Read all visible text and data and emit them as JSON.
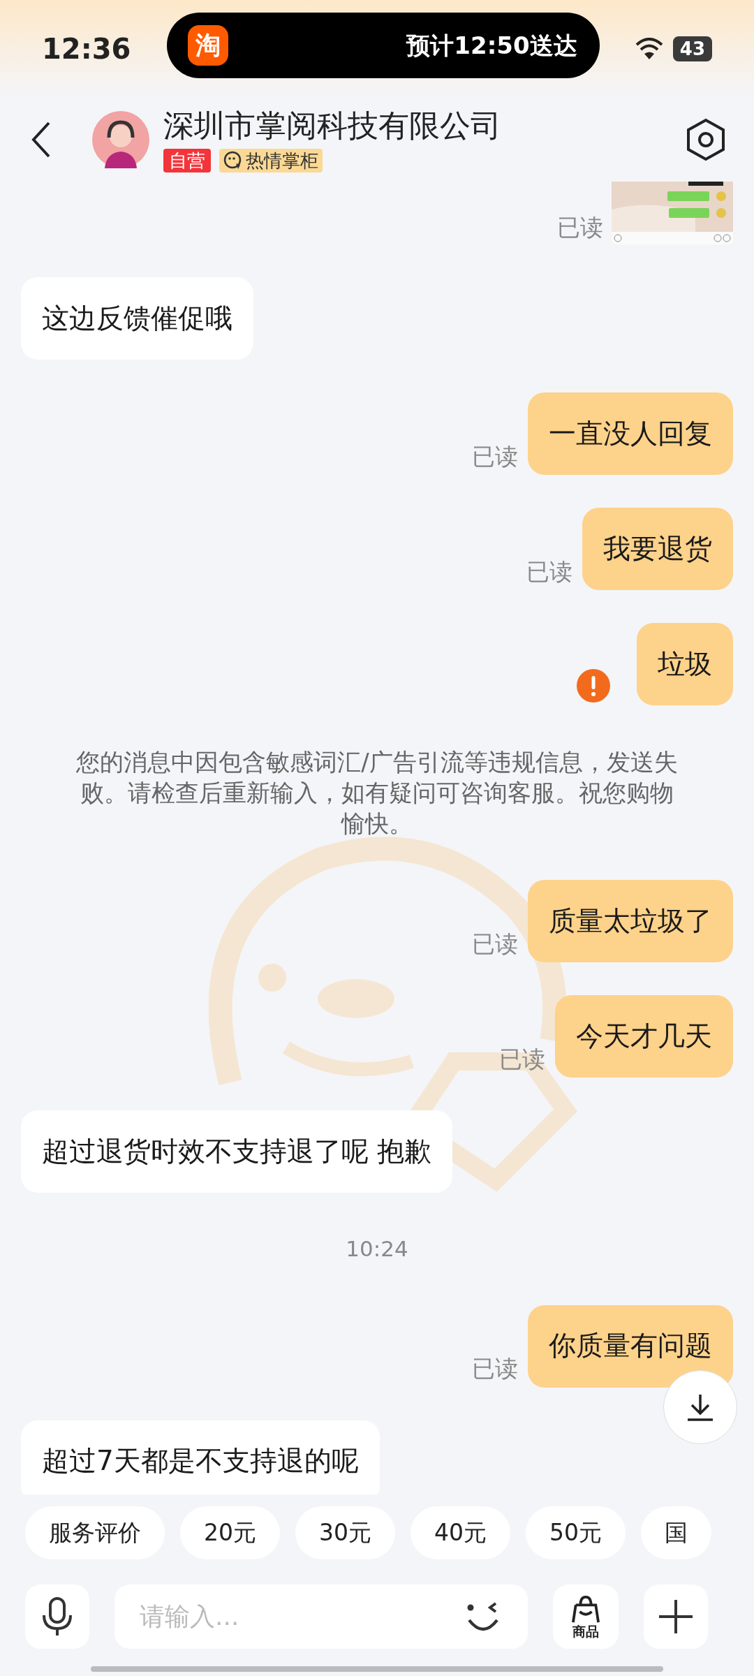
{
  "status_bar": {
    "time": "12:36",
    "island": {
      "app_glyph": "淘",
      "text": "预计12:50送达"
    },
    "battery": "43"
  },
  "header": {
    "title": "深圳市掌阅科技有限公司",
    "badges": [
      {
        "kind": "official",
        "label": "自营"
      },
      {
        "kind": "service",
        "label": "热情掌柜"
      }
    ]
  },
  "messages": [
    {
      "read_label": "已读",
      "failed": false
    },
    {
      "kind": "text",
      "outgoing": false,
      "text": "这边反馈催促哦"
    },
    {
      "kind": "text",
      "outgoing": true,
      "text": "一直没人回复",
      "read_label": "已读",
      "failed": false
    },
    {
      "kind": "text",
      "outgoing": true,
      "text": "我要退货",
      "read_label": "已读",
      "failed": false
    },
    {
      "kind": "text",
      "outgoing": true,
      "text": "垃圾",
      "failed": true
    },
    {
      "kind": "notice",
      "text": "您的消息中因包含敏感词汇/广告引流等违规信息，发送失败。请检查后重新输入，如有疑问可咨询客服。祝您购物愉快。"
    },
    {
      "kind": "text",
      "outgoing": true,
      "text": "质量太垃圾了",
      "read_label": "已读",
      "failed": false
    },
    {
      "kind": "text",
      "outgoing": true,
      "text": "今天才几天",
      "read_label": "已读",
      "failed": false
    },
    {
      "kind": "text",
      "outgoing": false,
      "text": "超过退货时效不支持退了呢 抱歉"
    },
    {
      "kind": "time",
      "text": "10:24"
    },
    {
      "kind": "text",
      "outgoing": true,
      "text": "你质量有问题",
      "read_label": "已读",
      "failed": false
    },
    {
      "kind": "text",
      "outgoing": false,
      "text": "超过7天都是不支持退的呢"
    }
  ],
  "quick_replies": [
    "服务评价",
    "20元",
    "30元",
    "40元",
    "50元",
    "国"
  ],
  "composer": {
    "placeholder": "请输入...",
    "product_label": "商品"
  }
}
